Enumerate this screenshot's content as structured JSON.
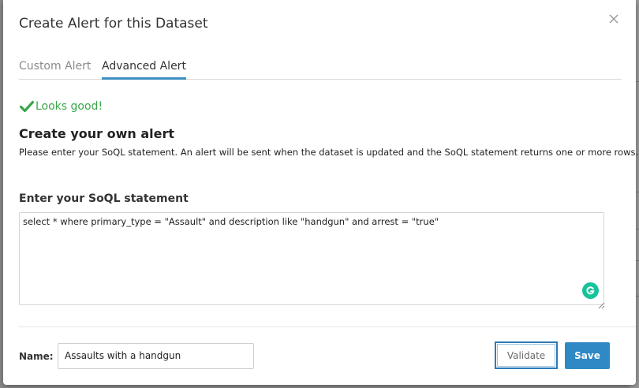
{
  "modal": {
    "title": "Create Alert for this Dataset"
  },
  "tabs": [
    {
      "label": "Custom Alert",
      "active": false
    },
    {
      "label": "Advanced Alert",
      "active": true
    }
  ],
  "validation": {
    "message": "Looks good!",
    "color": "#3aa64a"
  },
  "section": {
    "heading": "Create your own alert",
    "description": "Please enter your SoQL statement. An alert will be sent when the dataset is updated and the SoQL statement returns one or more rows."
  },
  "soql": {
    "label": "Enter your SoQL statement",
    "value": "select * where primary_type = \"Assault\" and description like \"handgun\" and arrest = \"true\""
  },
  "footer": {
    "name_label": "Name:",
    "name_value": "Assaults with a handgun",
    "validate_label": "Validate",
    "save_label": "Save"
  },
  "colors": {
    "accent": "#2f89c5",
    "grammarly": "#15c39a"
  }
}
